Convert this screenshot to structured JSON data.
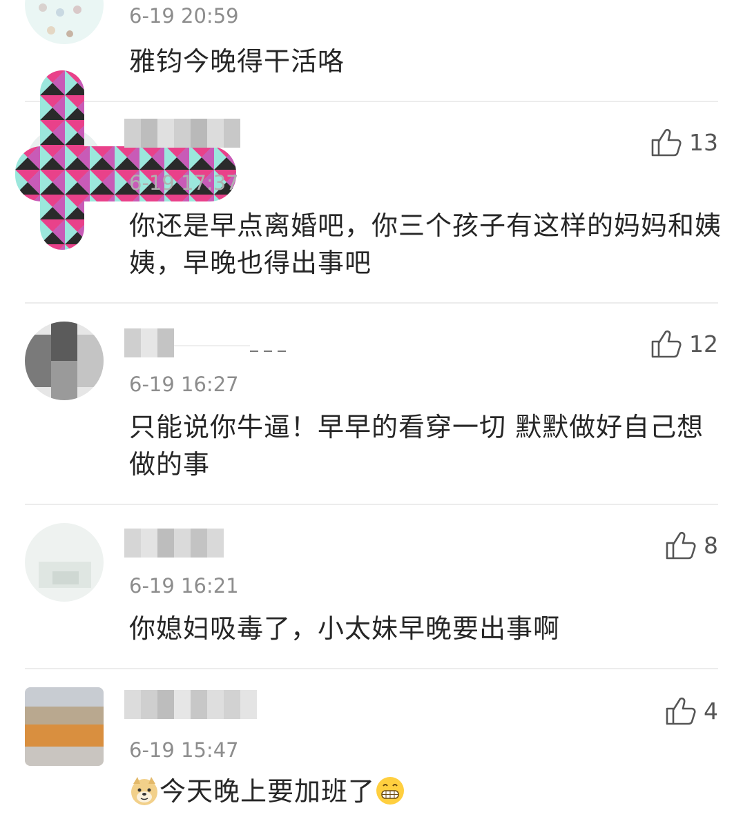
{
  "comments": [
    {
      "timestamp": "6-19 20:59",
      "text": "雅钧今晚得干活咯"
    },
    {
      "likes": "13",
      "timestamp": "6-19 17:37",
      "text": "你还是早点离婚吧，你三个孩子有这样的妈妈和姨姨，早晚也得出事吧"
    },
    {
      "likes": "12",
      "timestamp": "6-19 16:27",
      "text": "只能说你牛逼！早早的看穿一切 默默做好自己想做的事"
    },
    {
      "likes": "8",
      "timestamp": "6-19 16:21",
      "text": "你媳妇吸毒了，小太妹早晚要出事啊"
    },
    {
      "likes": "4",
      "timestamp": "6-19 15:47",
      "text": "今天晚上要加班了"
    }
  ],
  "icons": {
    "like": "thumbs-up-icon",
    "emoji_start": "doge-emoji-icon",
    "emoji_end": "grin-emoji-icon"
  },
  "colors": {
    "text": "#262626",
    "meta": "#8d8d8d",
    "divider": "#ececec"
  }
}
